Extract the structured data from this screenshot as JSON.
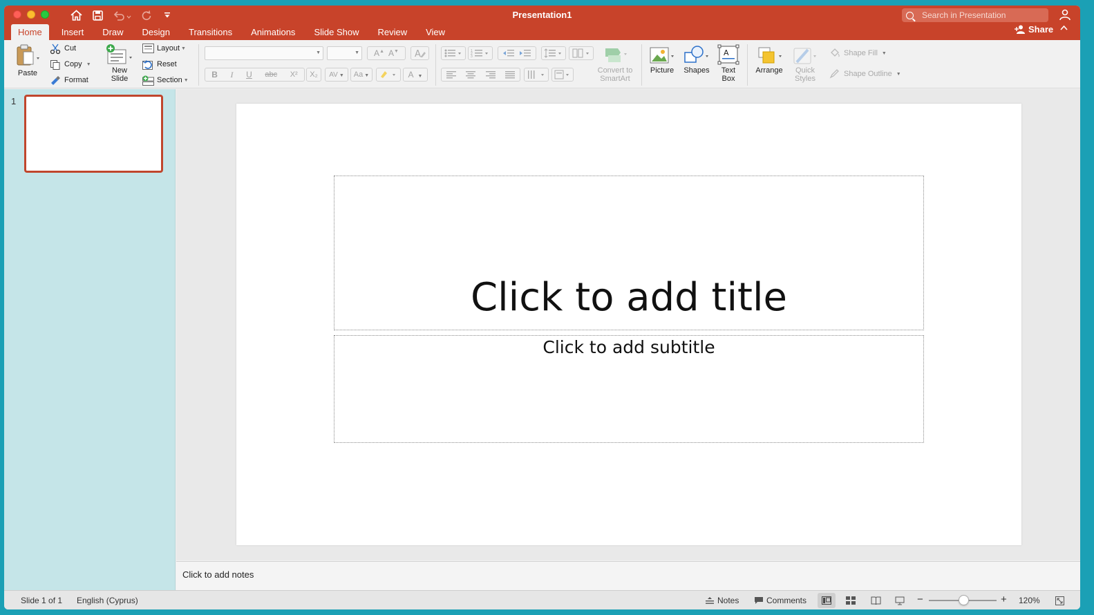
{
  "window": {
    "title": "Presentation1",
    "search_placeholder": "Search in Presentation",
    "share_label": "Share"
  },
  "tabs": [
    "Home",
    "Insert",
    "Draw",
    "Design",
    "Transitions",
    "Animations",
    "Slide Show",
    "Review",
    "View"
  ],
  "active_tab": "Home",
  "ribbon": {
    "paste": "Paste",
    "cut": "Cut",
    "copy": "Copy",
    "format": "Format",
    "new_slide_line1": "New",
    "new_slide_line2": "Slide",
    "layout": "Layout",
    "reset": "Reset",
    "section": "Section",
    "convert_line1": "Convert to",
    "convert_line2": "SmartArt",
    "picture": "Picture",
    "shapes": "Shapes",
    "textbox_line1": "Text",
    "textbox_line2": "Box",
    "arrange": "Arrange",
    "quick_styles_line1": "Quick",
    "quick_styles_line2": "Styles",
    "shape_fill": "Shape Fill",
    "shape_outline": "Shape Outline"
  },
  "format_buttons": {
    "bold": "B",
    "italic": "I",
    "underline": "U",
    "strike": "abc",
    "superscript": "X²",
    "subscript": "X₂"
  },
  "slides": [
    {
      "number": "1"
    }
  ],
  "slide": {
    "title_placeholder": "Click to add title",
    "subtitle_placeholder": "Click to add subtitle"
  },
  "notes_placeholder": "Click to add notes",
  "status": {
    "slide_info": "Slide 1 of 1",
    "language": "English (Cyprus)",
    "notes": "Notes",
    "comments": "Comments",
    "zoom": "120%"
  },
  "zoom_level": 1.2,
  "colors": {
    "accent": "#c8432a",
    "thumb_pane": "#c5e5e8",
    "desktop": "#1ba0b5"
  }
}
